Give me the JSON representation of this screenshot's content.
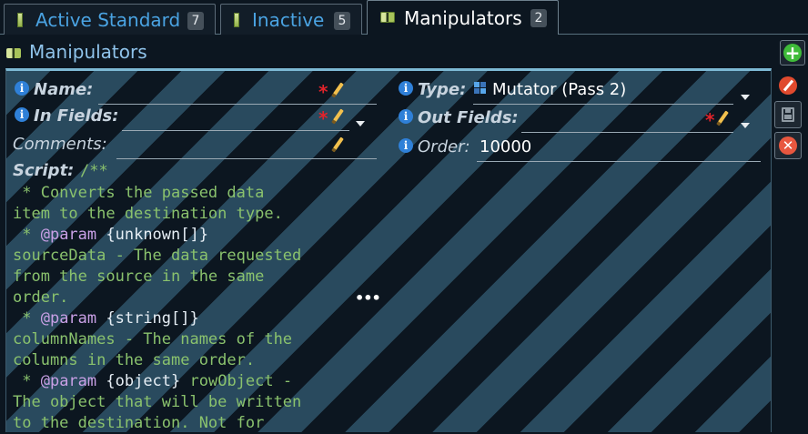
{
  "tabs": [
    {
      "label": "Active Standard",
      "count": "7"
    },
    {
      "label": "Inactive",
      "count": "5"
    },
    {
      "label": "Manipulators",
      "count": "2"
    }
  ],
  "section": {
    "title": "Manipulators"
  },
  "form": {
    "name": {
      "label": "Name:",
      "value": ""
    },
    "type": {
      "label": "Type:",
      "value": "Mutator (Pass 2)"
    },
    "in_fields": {
      "label": "In Fields:",
      "value": ""
    },
    "out_fields": {
      "label": "Out Fields:",
      "value": ""
    },
    "comments": {
      "label": "Comments:",
      "value": ""
    },
    "order": {
      "label": "Order:",
      "value": "10000"
    },
    "script": {
      "label": "Script:",
      "first_line": "/**",
      "lines": [
        [
          " * Converts the passed data",
          ""
        ],
        [
          "item to the destination type.",
          ""
        ]
      ]
    }
  },
  "script_lines": [
    {
      "parts": [
        {
          "t": " * Converts the passed data",
          "c": ""
        }
      ]
    },
    {
      "parts": [
        {
          "t": "item to the destination type.",
          "c": ""
        }
      ]
    },
    {
      "parts": [
        {
          "t": " * ",
          "c": ""
        },
        {
          "t": "@param",
          "c": "tag"
        },
        {
          "t": " {unknown[]}",
          "c": "typ"
        }
      ]
    },
    {
      "parts": [
        {
          "t": "sourceData - The data requested",
          "c": ""
        }
      ]
    },
    {
      "parts": [
        {
          "t": "from the source in the same",
          "c": ""
        }
      ]
    },
    {
      "parts": [
        {
          "t": "order.",
          "c": ""
        }
      ]
    },
    {
      "parts": [
        {
          "t": " * ",
          "c": ""
        },
        {
          "t": "@param",
          "c": "tag"
        },
        {
          "t": " {string[]}",
          "c": "typ"
        }
      ]
    },
    {
      "parts": [
        {
          "t": "columnNames - The names of the",
          "c": ""
        }
      ]
    },
    {
      "parts": [
        {
          "t": "columns in the same order.",
          "c": ""
        }
      ]
    },
    {
      "parts": [
        {
          "t": " * ",
          "c": ""
        },
        {
          "t": "@param",
          "c": "tag"
        },
        {
          "t": " {object}",
          "c": "typ"
        },
        {
          "t": " rowObject -",
          "c": ""
        }
      ]
    },
    {
      "parts": [
        {
          "t": "The object that will be written",
          "c": ""
        }
      ]
    },
    {
      "parts": [
        {
          "t": "to the destination. Not for",
          "c": ""
        }
      ]
    }
  ],
  "more_indicator": "•••",
  "colors": {
    "accent": "#4aa3e2",
    "stripe": "#294a5e",
    "required": "#e2232a",
    "code_comment": "#8ac26d"
  }
}
